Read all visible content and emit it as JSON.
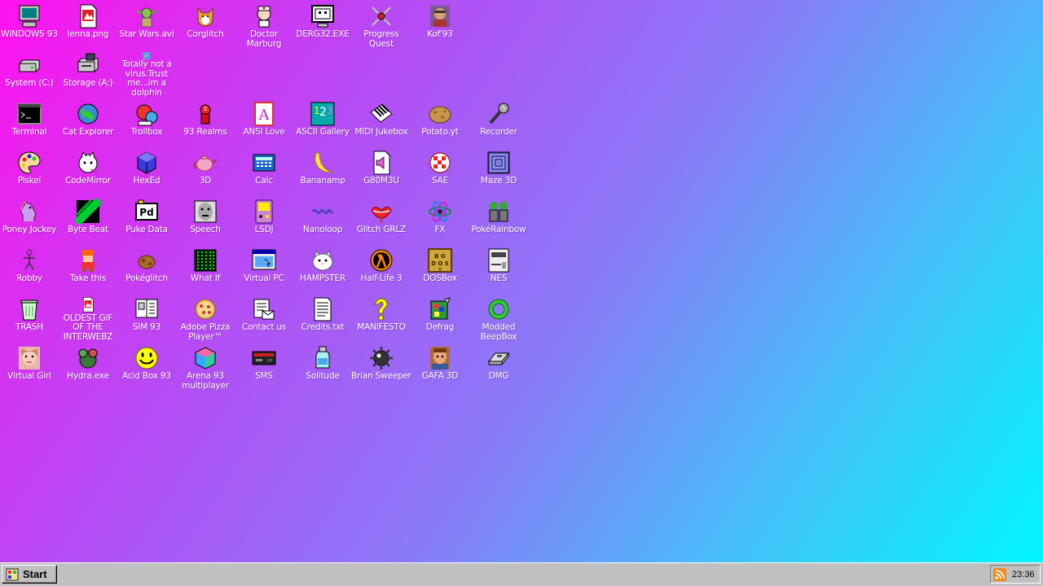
{
  "desktop": {
    "background_colors": [
      "#ff12ee",
      "#b54cf5",
      "#8a7af8",
      "#3fc6fa",
      "#00f6ff"
    ],
    "icons": [
      {
        "label": "WINDOWS 93",
        "icon": "computer-icon"
      },
      {
        "label": "lenna.png",
        "icon": "image-file-icon"
      },
      {
        "label": "Star Wars.avi",
        "icon": "yoda-icon"
      },
      {
        "label": "Corglitch",
        "icon": "corgi-icon"
      },
      {
        "label": "Doctor Marburg",
        "icon": "doctor-icon"
      },
      {
        "label": "DERG32.EXE",
        "icon": "monitor-face-icon"
      },
      {
        "label": "Progress Quest",
        "icon": "crossed-swords-icon"
      },
      {
        "label": "Kof'93",
        "icon": "fighter-icon"
      },
      {
        "label": "System (C:)",
        "icon": "hard-drive-icon"
      },
      {
        "label": "Storage (A:)",
        "icon": "floppy-drive-icon"
      },
      {
        "label": "Totally not a virus.Trust me...im a dolphin",
        "icon": "dolphin-icon"
      },
      {
        "label": "Terminal",
        "icon": "terminal-icon"
      },
      {
        "label": "Cat Explorer",
        "icon": "globe-icon"
      },
      {
        "label": "Trollbox",
        "icon": "chat-icon"
      },
      {
        "label": "93 Realms",
        "icon": "knight-icon"
      },
      {
        "label": "ANSI Love",
        "icon": "ansi-icon"
      },
      {
        "label": "ASCII Gallery",
        "icon": "numbers-icon"
      },
      {
        "label": "MIDI Jukebox",
        "icon": "piano-icon"
      },
      {
        "label": "Potato.yt",
        "icon": "potato-icon"
      },
      {
        "label": "Recorder",
        "icon": "microphone-icon"
      },
      {
        "label": "Piskel",
        "icon": "palette-icon"
      },
      {
        "label": "CodeMirror",
        "icon": "cat-icon"
      },
      {
        "label": "HexEd",
        "icon": "cube-icon"
      },
      {
        "label": "3D",
        "icon": "teapot-icon"
      },
      {
        "label": "Calc",
        "icon": "calculator-icon"
      },
      {
        "label": "Bananamp",
        "icon": "banana-icon"
      },
      {
        "label": "G80M3U",
        "icon": "speaker-file-icon"
      },
      {
        "label": "SAE",
        "icon": "ball-icon"
      },
      {
        "label": "Maze 3D",
        "icon": "maze-icon"
      },
      {
        "label": "Poney Jockey",
        "icon": "pony-icon"
      },
      {
        "label": "Byte Beat",
        "icon": "wave-icon"
      },
      {
        "label": "Puke Data",
        "icon": "pd-icon"
      },
      {
        "label": "Speech",
        "icon": "face-icon"
      },
      {
        "label": "LSDJ",
        "icon": "gameboy-icon"
      },
      {
        "label": "Nanoloop",
        "icon": "sound-icon"
      },
      {
        "label": "Glitch GRLZ",
        "icon": "lips-icon"
      },
      {
        "label": "FX",
        "icon": "atom-icon"
      },
      {
        "label": "PokéRainbow",
        "icon": "trainers-icon"
      },
      {
        "label": "Robby",
        "icon": "stick-figure-icon"
      },
      {
        "label": "Take this",
        "icon": "pixel-character-icon"
      },
      {
        "label": "Pokéglitch",
        "icon": "rock-icon"
      },
      {
        "label": "What If",
        "icon": "matrix-icon"
      },
      {
        "label": "Virtual PC",
        "icon": "window-icon"
      },
      {
        "label": "HAMPSTER",
        "icon": "hamster-icon"
      },
      {
        "label": "Half-Life 3",
        "icon": "lambda-icon"
      },
      {
        "label": "DOSBox",
        "icon": "dosbox-icon"
      },
      {
        "label": "NES",
        "icon": "nes-icon"
      },
      {
        "label": "TRASH",
        "icon": "trash-icon"
      },
      {
        "label": "OLDEST GIF OF THE INTERWEBZ",
        "icon": "gif-file-icon"
      },
      {
        "label": "SIM 93",
        "icon": "book-icon"
      },
      {
        "label": "Adobe Pizza Player™",
        "icon": "pizza-icon"
      },
      {
        "label": "Contact us",
        "icon": "letter-icon"
      },
      {
        "label": "Credits.txt",
        "icon": "text-file-icon"
      },
      {
        "label": "MANIFESTO",
        "icon": "question-icon"
      },
      {
        "label": "Defrag",
        "icon": "defrag-icon"
      },
      {
        "label": "Modded BeepBox",
        "icon": "ring-icon"
      },
      {
        "label": "Virtual Girl",
        "icon": "girl-face-icon"
      },
      {
        "label": "Hydra.exe",
        "icon": "hydra-icon"
      },
      {
        "label": "Acid Box 93",
        "icon": "smiley-icon"
      },
      {
        "label": "Arena 93 multiplayer",
        "icon": "colored-cube-icon"
      },
      {
        "label": "SMS",
        "icon": "console-icon"
      },
      {
        "label": "Solitude",
        "icon": "bottle-icon"
      },
      {
        "label": "Brian Sweeper",
        "icon": "mine-icon"
      },
      {
        "label": "GAFA 3D",
        "icon": "gafa-icon"
      },
      {
        "label": "DMG",
        "icon": "disk-icon"
      }
    ]
  },
  "taskbar": {
    "start_label": "Start",
    "clock": "23:36",
    "tray_icon": "rss-icon"
  }
}
